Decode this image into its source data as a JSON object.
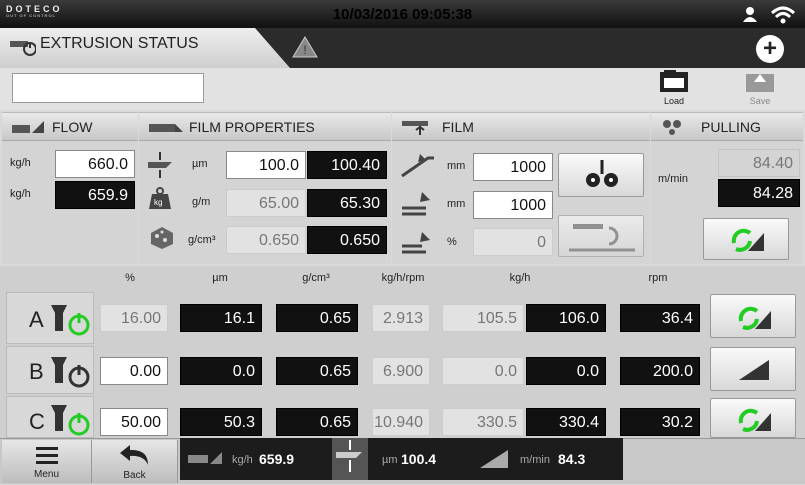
{
  "header": {
    "logo": "DOTECO",
    "logo_tagline": "OUT OF CONTROL",
    "datetime": "10/03/2016 09:05:38",
    "title": "EXTRUSION STATUS"
  },
  "toolbar": {
    "name_value": "",
    "load_label": "Load",
    "save_label": "Save"
  },
  "flow": {
    "title": "FLOW",
    "unit1": "kg/h",
    "set": "660.0",
    "unit2": "kg/h",
    "actual": "659.9"
  },
  "film_properties": {
    "title": "FILM PROPERTIES",
    "thickness": {
      "unit": "µm",
      "set": "100.0",
      "actual": "100.40"
    },
    "weight": {
      "icon_text": "kg",
      "unit": "g/m",
      "set": "65.00",
      "actual": "65.30"
    },
    "density": {
      "unit": "g/cm³",
      "set": "0.650",
      "actual": "0.650"
    }
  },
  "film": {
    "title": "FILM",
    "width": {
      "unit": "mm",
      "value": "1000"
    },
    "layflat": {
      "unit": "mm",
      "value": "1000"
    },
    "trim": {
      "unit": "%",
      "value": "0"
    }
  },
  "pulling": {
    "title": "PULLING",
    "unit": "m/min",
    "set": "84.40",
    "actual": "84.28"
  },
  "table": {
    "headers": [
      "%",
      "µm",
      "g/cm³",
      "kg/h/rpm",
      "kg/h",
      "rpm"
    ],
    "rows": [
      {
        "label": "A",
        "pct": "16.00",
        "um": "16.1",
        "density": "0.65",
        "ratio": "2.913",
        "kgh_set": "105.5",
        "kgh_act": "106.0",
        "rpm": "36.4"
      },
      {
        "label": "B",
        "pct": "0.00",
        "um": "0.0",
        "density": "0.65",
        "ratio": "6.900",
        "kgh_set": "0.0",
        "kgh_act": "0.0",
        "rpm": "200.0"
      },
      {
        "label": "C",
        "pct": "50.00",
        "um": "50.3",
        "density": "0.65",
        "ratio": "10.940",
        "kgh_set": "330.5",
        "kgh_act": "330.4",
        "rpm": "30.2"
      }
    ]
  },
  "bottom": {
    "menu_label": "Menu",
    "back_label": "Back",
    "flow_unit": "kg/h",
    "flow_value": "659.9",
    "thick_unit": "µm",
    "thick_value": "100.4",
    "speed_unit": "m/min",
    "speed_value": "84.3"
  },
  "colors": {
    "accent_green": "#22cc22",
    "dark_field": "#111111"
  }
}
